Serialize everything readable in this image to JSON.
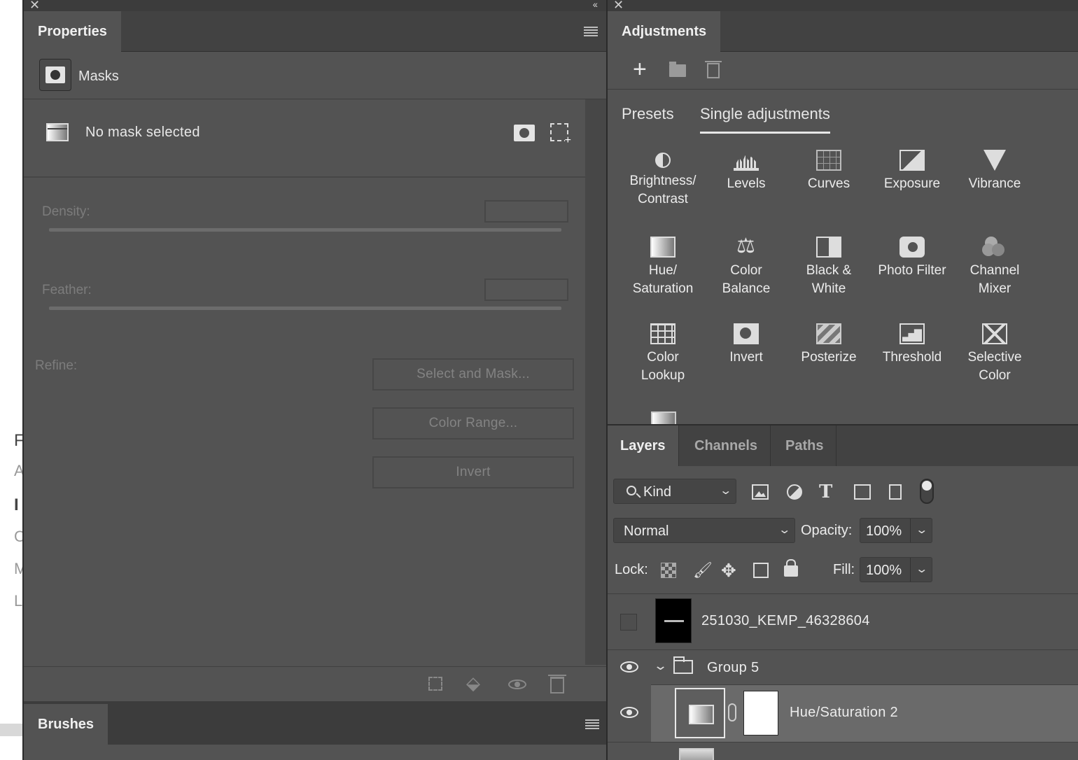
{
  "properties": {
    "tab_label": "Properties",
    "section_label": "Masks",
    "no_mask_label": "No mask selected",
    "density_label": "Density:",
    "feather_label": "Feather:",
    "refine_label": "Refine:",
    "select_and_mask_label": "Select and Mask...",
    "color_range_label": "Color Range...",
    "invert_label": "Invert"
  },
  "brushes": {
    "tab_label": "Brushes"
  },
  "adjustments": {
    "tab_label": "Adjustments",
    "tabs": [
      "Presets",
      "Single adjustments"
    ],
    "active_tab": "Single adjustments",
    "items": [
      {
        "label": "Brightness/\nContrast",
        "icon": "brightness-contrast-icon"
      },
      {
        "label": "Levels",
        "icon": "levels-icon"
      },
      {
        "label": "Curves",
        "icon": "curves-icon"
      },
      {
        "label": "Exposure",
        "icon": "exposure-icon"
      },
      {
        "label": "Vibrance",
        "icon": "vibrance-icon"
      },
      {
        "label": "Hue/\nSaturation",
        "icon": "hue-saturation-icon"
      },
      {
        "label": "Color\nBalance",
        "icon": "color-balance-icon"
      },
      {
        "label": "Black &\nWhite",
        "icon": "black-white-icon"
      },
      {
        "label": "Photo Filter",
        "icon": "photo-filter-icon"
      },
      {
        "label": "Channel\nMixer",
        "icon": "channel-mixer-icon"
      },
      {
        "label": "Color\nLookup",
        "icon": "color-lookup-icon"
      },
      {
        "label": "Invert",
        "icon": "invert-icon"
      },
      {
        "label": "Posterize",
        "icon": "posterize-icon"
      },
      {
        "label": "Threshold",
        "icon": "threshold-icon"
      },
      {
        "label": "Selective\nColor",
        "icon": "selective-color-icon"
      }
    ]
  },
  "layers": {
    "tabs": [
      "Layers",
      "Channels",
      "Paths"
    ],
    "active_tab": "Layers",
    "filter_kind": "Kind",
    "blend_mode": "Normal",
    "opacity_label": "Opacity:",
    "opacity_value": "100%",
    "lock_label": "Lock:",
    "fill_label": "Fill:",
    "fill_value": "100%",
    "rows": [
      {
        "name": "251030_KEMP_46328604",
        "visible": false,
        "type": "image"
      },
      {
        "name": "Group 5",
        "visible": true,
        "type": "group",
        "expanded": true
      },
      {
        "name": "Hue/Saturation 2",
        "visible": true,
        "type": "adjustment",
        "selected": true
      }
    ]
  },
  "colors": {
    "panel_bg": "#535353",
    "tabbar_bg": "#424242",
    "selected_row_bg": "#6a6a6a",
    "text": "#e6e6e6",
    "disabled_text": "#7c7c7c"
  }
}
